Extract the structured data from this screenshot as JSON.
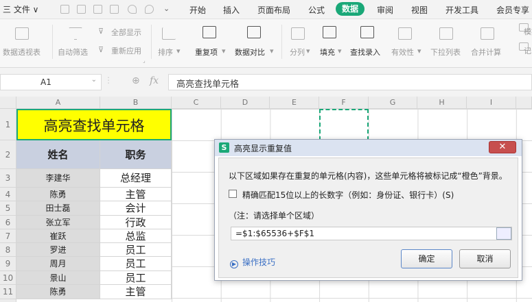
{
  "menubar": {
    "file_label": "三 文件 ∨",
    "tabs": [
      "开始",
      "插入",
      "页面布局",
      "公式",
      "数据",
      "审阅",
      "视图",
      "开发工具",
      "会员专享"
    ],
    "active_tab": "数据"
  },
  "ribbon": {
    "items": [
      "数据透视表",
      "自动筛选",
      "全部显示",
      "重新应用",
      "排序",
      "重复项",
      "数据对比",
      "分列",
      "填充",
      "查找录入",
      "有效性",
      "下拉列表",
      "合并计算",
      "模拟分析",
      "记录单"
    ]
  },
  "formula_bar": {
    "cell_ref": "A1",
    "fx": "fx",
    "content": "高亮查找单元格"
  },
  "grid": {
    "columns": [
      "A",
      "B",
      "C",
      "D",
      "E",
      "F",
      "G",
      "H",
      "I"
    ],
    "rows": [
      "1",
      "2",
      "3",
      "4",
      "5",
      "6",
      "7",
      "8",
      "9",
      "10",
      "11"
    ],
    "title": "高亮查找单元格",
    "headers": [
      "姓名",
      "职务"
    ],
    "data": [
      [
        "李建华",
        "总经理"
      ],
      [
        "陈勇",
        "主管"
      ],
      [
        "田士磊",
        "会计"
      ],
      [
        "张立军",
        "行政"
      ],
      [
        "崔跃",
        "总监"
      ],
      [
        "罗进",
        "员工"
      ],
      [
        "周月",
        "员工"
      ],
      [
        "景山",
        "员工"
      ],
      [
        "陈勇",
        "主管"
      ]
    ],
    "colors": {
      "title_bg": "#ffff00",
      "header_bg": "#c9d0e0",
      "data_bg": "#dcdcdc",
      "selected": "#1aa878"
    }
  },
  "dialog": {
    "title": "高亮显示重复值",
    "description": "以下区域如果存在重复的单元格(内容)，这些单元格将被标记成“橙色”背景。",
    "checkbox_label": "精确匹配15位以上的长数字（例如：身份证、银行卡）(S)",
    "note": "（注：请选择单个区域）",
    "range_value": "=$1:$65536+$F$1",
    "tips_label": "操作技巧",
    "ok_label": "确定",
    "cancel_label": "取消",
    "close_symbol": "✕"
  }
}
